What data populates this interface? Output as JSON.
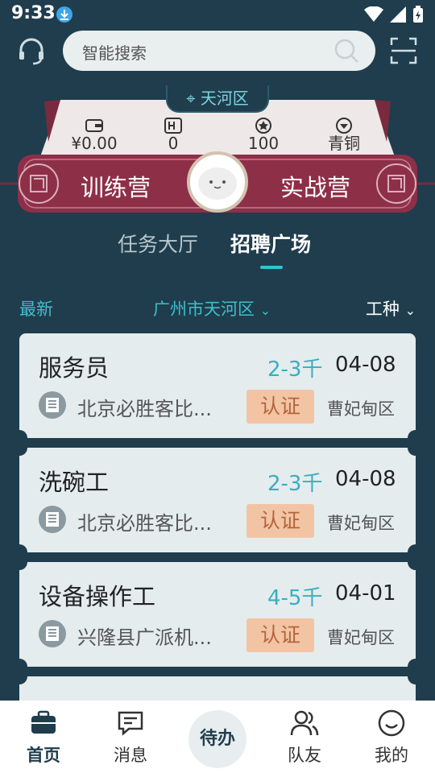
{
  "status_bar": {
    "time": "9:33"
  },
  "search": {
    "placeholder": "智能搜索"
  },
  "banner": {
    "district": "天河区",
    "stats": [
      {
        "icon": "wallet-icon",
        "value": "¥0.00"
      },
      {
        "icon": "h-coin-icon",
        "value": "0"
      },
      {
        "icon": "star-icon",
        "value": "100"
      },
      {
        "icon": "rank-icon",
        "value": "青铜"
      }
    ],
    "left_label": "训练营",
    "right_label": "实战营"
  },
  "tabs": [
    {
      "label": "任务大厅",
      "active": false
    },
    {
      "label": "招聘广场",
      "active": true
    }
  ],
  "filters": {
    "sort": "最新",
    "area": "广州市天河区",
    "job_type": "工种"
  },
  "jobs": [
    {
      "title": "服务员",
      "salary": "2-3千",
      "date": "04-08",
      "company": "北京必胜客比...",
      "badge": "认证",
      "area": "曹妃甸区"
    },
    {
      "title": "洗碗工",
      "salary": "2-3千",
      "date": "04-08",
      "company": "北京必胜客比...",
      "badge": "认证",
      "area": "曹妃甸区"
    },
    {
      "title": "设备操作工",
      "salary": "4-5千",
      "date": "04-01",
      "company": "兴隆县广派机...",
      "badge": "认证",
      "area": "曹妃甸区"
    }
  ],
  "nav": [
    {
      "label": "首页",
      "icon": "briefcase-icon",
      "active": true
    },
    {
      "label": "消息",
      "icon": "message-icon",
      "active": false
    },
    {
      "label": "待办",
      "icon": "",
      "active": false
    },
    {
      "label": "队友",
      "icon": "users-icon",
      "active": false
    },
    {
      "label": "我的",
      "icon": "profile-icon",
      "active": false
    }
  ],
  "colors": {
    "background": "#1f3d4d",
    "accent": "#3fbfcc",
    "banner": "#8e2f48",
    "badge": "#f2c4a4"
  }
}
